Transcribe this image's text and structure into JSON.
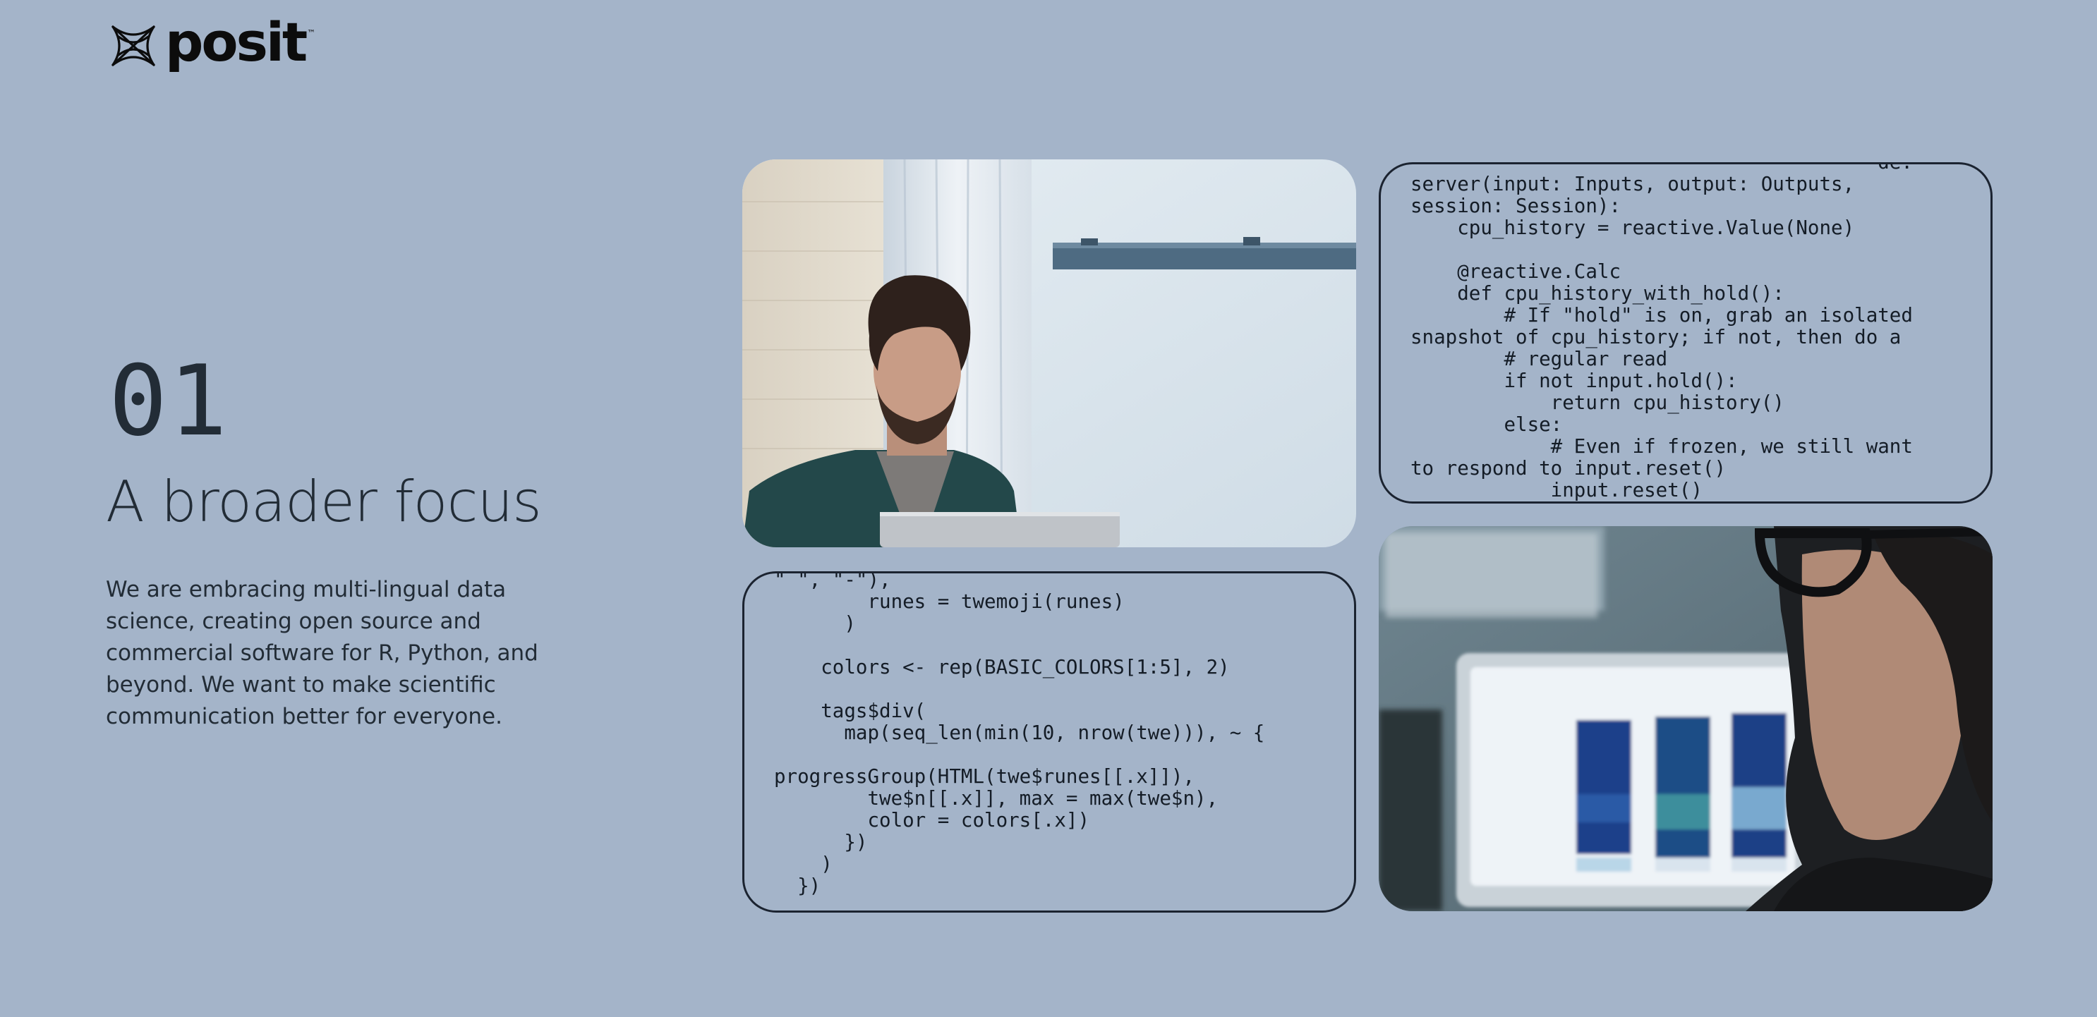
{
  "brand": {
    "name": "posit",
    "trademark": "™",
    "logo_icon": "posit-knot-icon"
  },
  "section": {
    "number": "01",
    "title": "A broader focus",
    "body": "We are embracing multi-lingual data science, creating open source and commercial software for R, Python, and beyond. We want to make scientific communication better for everyone."
  },
  "tiles": {
    "photo_top_left": {
      "icon": "photo-man-at-laptop"
    },
    "code_python": {
      "lines": [
        "                                        de:",
        "server(input: Inputs, output: Outputs,",
        "session: Session):",
        "    cpu_history = reactive.Value(None)",
        "",
        "    @reactive.Calc",
        "    def cpu_history_with_hold():",
        "        # If \"hold\" is on, grab an isolated",
        "snapshot of cpu_history; if not, then do a",
        "        # regular read",
        "        if not input.hold():",
        "            return cpu_history()",
        "        else:",
        "            # Even if frozen, we still want",
        "to respond to input.reset()",
        "            input.reset()"
      ]
    },
    "code_r": {
      "lines": [
        "\" \", \"-\"),",
        "        runes = twemoji(runes)",
        "      )",
        "",
        "    colors <- rep(BASIC_COLORS[1:5], 2)",
        "",
        "    tags$div(",
        "      map(seq_len(min(10, nrow(twe))), ~ {",
        "",
        "progressGroup(HTML(twe$runes[[.x]]),",
        "        twe$n[[.x]], max = max(twe$n),",
        "        color = colors[.x])",
        "      })",
        "    )",
        "  })"
      ]
    },
    "photo_bottom_right": {
      "icon": "photo-woman-viewing-chart"
    }
  },
  "colors": {
    "background": "#a4b4c9",
    "text": "#222c36",
    "border": "#1b2330"
  }
}
